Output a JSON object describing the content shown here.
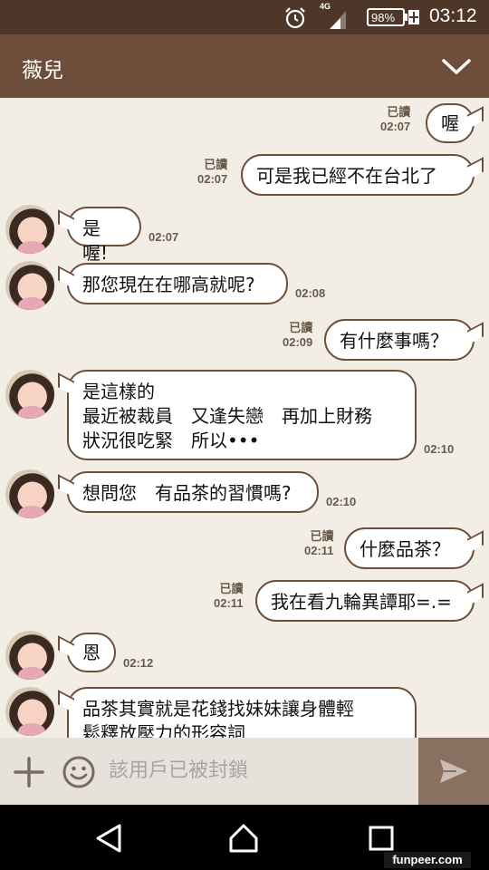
{
  "status_bar": {
    "network": "4G",
    "battery": "98%",
    "time": "03:12"
  },
  "header": {
    "title": "薇兒"
  },
  "messages": [
    {
      "dir": "out",
      "text": "喔",
      "read": "已讀",
      "time": "02:07"
    },
    {
      "dir": "out",
      "text": "可是我已經不在台北了",
      "read": "已讀",
      "time": "02:07"
    },
    {
      "dir": "in",
      "text": "是喔!",
      "time": "02:07"
    },
    {
      "dir": "in",
      "text": "那您現在在哪高就呢?",
      "time": "02:08"
    },
    {
      "dir": "out",
      "text": "有什麼事嗎？",
      "read": "已讀",
      "time": "02:09"
    },
    {
      "dir": "in",
      "text": "是這樣的\n最近被裁員　又逢失戀　再加上財務\n狀況很吃緊　所以•••",
      "time": "02:10"
    },
    {
      "dir": "in",
      "text": "想問您　有品茶的習慣嗎?",
      "time": "02:10"
    },
    {
      "dir": "out",
      "text": "什麼品茶？",
      "read": "已讀",
      "time": "02:11"
    },
    {
      "dir": "out",
      "text": "我在看九輪異譚耶=.=",
      "read": "已讀",
      "time": "02:11"
    },
    {
      "dir": "in",
      "text": "恩",
      "time": "02:12"
    },
    {
      "dir": "in",
      "text": "品茶其實就是花錢找妹妹讓身體輕\n鬆釋放壓力的形容詞",
      "time": ""
    }
  ],
  "input": {
    "placeholder": "該用戶已被封鎖"
  },
  "icons": {
    "alarm": "alarm-clock-icon",
    "signal": "signal-icon",
    "battery": "battery-charging-icon",
    "chevron": "chevron-down-icon",
    "plus": "plus-icon",
    "emoji": "emoji-icon",
    "send": "send-icon",
    "back": "nav-back-icon",
    "home": "nav-home-icon",
    "recent": "nav-recent-icon"
  },
  "colors": {
    "header": "#6e4e3a",
    "status_bar": "#4e3628",
    "chat_bg": "#f2ede5",
    "bubble_border": "#6e4e3a",
    "send_button": "#8a7060"
  },
  "watermark": "funpeer.com"
}
